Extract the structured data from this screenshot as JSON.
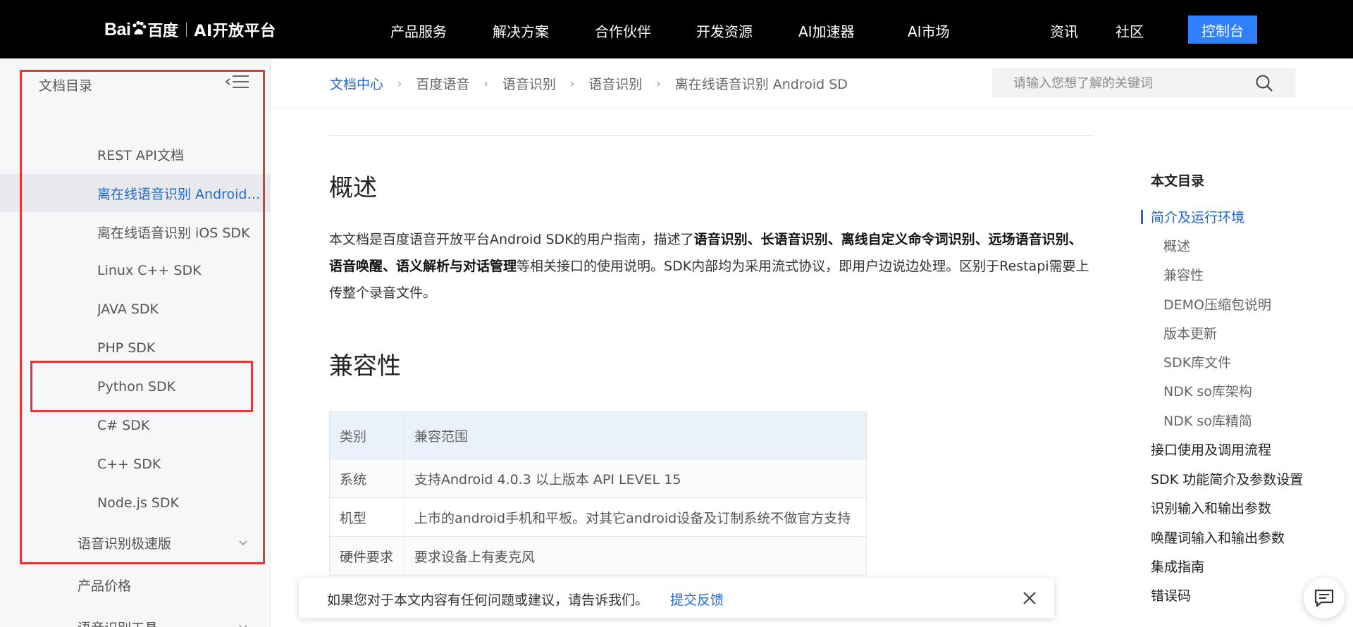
{
  "header": {
    "logo_brand": "Bai",
    "logo_brand_cn": "百度",
    "logo_platform": "AI开放平台",
    "nav": [
      "产品服务",
      "解决方案",
      "合作伙伴",
      "开发资源",
      "AI加速器",
      "AI市场"
    ],
    "right_nav": [
      "资讯",
      "社区"
    ],
    "console_label": "控制台"
  },
  "sidebar": {
    "title": "文档目录",
    "items": [
      {
        "label": "REST API文档"
      },
      {
        "label": "离在线语音识别 Android SDK"
      },
      {
        "label": "离在线语音识别 iOS SDK"
      },
      {
        "label": "Linux C++ SDK"
      },
      {
        "label": "JAVA SDK"
      },
      {
        "label": "PHP SDK"
      },
      {
        "label": "Python SDK"
      },
      {
        "label": "C# SDK"
      },
      {
        "label": "C++ SDK"
      },
      {
        "label": "Node.js SDK"
      },
      {
        "label": "语音识别极速版"
      },
      {
        "label": "产品价格"
      },
      {
        "label": "语音识别工具"
      }
    ]
  },
  "breadcrumb": [
    "文档中心",
    "百度语音",
    "语音识别",
    "语音识别",
    "离在线语音识别 Android SD"
  ],
  "search": {
    "placeholder": "请输入您想了解的关键词"
  },
  "main": {
    "h_overview": "概述",
    "para_1": "本文档是百度语音开放平台Android SDK的用户指南，描述了",
    "para_bold": "语音识别、长语音识别、离线自定义命令词识别、远场语音识别、语音唤醒、语义解析与对话管理",
    "para_2": "等相关接口的使用说明。SDK内部均为采用流式协议，即用户边说边处理。区别于Restapi需要上传整个录音文件。",
    "h_compat": "兼容性",
    "table": {
      "headers": [
        "类别",
        "兼容范围"
      ],
      "rows": [
        [
          "系统",
          "支持Android 4.0.3 以上版本 API LEVEL 15"
        ],
        [
          "机型",
          "上市的android手机和平板。对其它android设备及订制系统不做官方支持"
        ],
        [
          "硬件要求",
          "要求设备上有麦克风"
        ]
      ]
    }
  },
  "toc": {
    "title": "本文目录",
    "items": [
      {
        "label": "简介及运行环境"
      },
      {
        "label": "概述"
      },
      {
        "label": "兼容性"
      },
      {
        "label": "DEMO压缩包说明"
      },
      {
        "label": "版本更新"
      },
      {
        "label": "SDK库文件"
      },
      {
        "label": "NDK so库架构"
      },
      {
        "label": "NDK so库精简"
      },
      {
        "label": "接口使用及调用流程"
      },
      {
        "label": "SDK 功能简介及参数设置"
      },
      {
        "label": "识别输入和输出参数"
      },
      {
        "label": "唤醒词输入和输出参数"
      },
      {
        "label": "集成指南"
      },
      {
        "label": "错误码"
      }
    ]
  },
  "feedback": {
    "text": "如果您对于本文内容有任何问题或建议，请告诉我们。",
    "link": "提交反馈"
  },
  "colors": {
    "accent": "#2f7fff",
    "link": "#2468d6",
    "highlight_box": "#e53935"
  }
}
